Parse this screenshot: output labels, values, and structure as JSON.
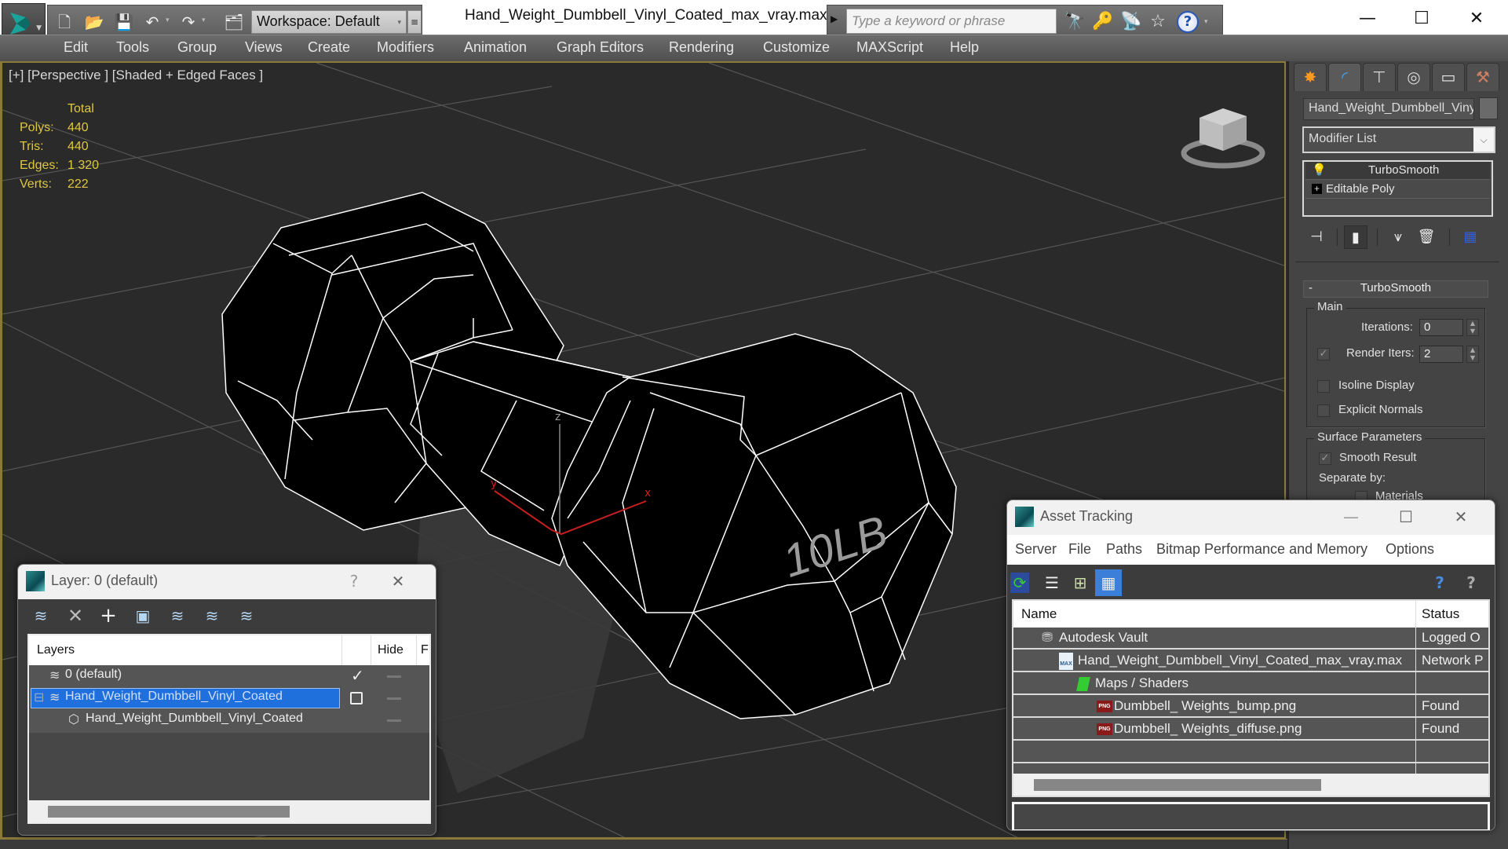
{
  "window": {
    "title": "Hand_Weight_Dumbbell_Vinyl_Coated_max_vray.max",
    "workspace_label": "Workspace: Default",
    "search_placeholder": "Type a keyword or phrase",
    "help_label": "?",
    "minimize": "—",
    "maximize": "☐",
    "close": "✕"
  },
  "quick_access": [
    {
      "icon": "new-file-icon",
      "glyph": "🗋"
    },
    {
      "icon": "open-folder-icon",
      "glyph": "📂"
    },
    {
      "icon": "save-icon",
      "glyph": "💾"
    },
    {
      "icon": "undo-icon",
      "glyph": "↶"
    },
    {
      "icon": "redo-icon",
      "glyph": "↷"
    },
    {
      "icon": "project-folder-icon",
      "glyph": "🗂"
    }
  ],
  "search_icons": [
    {
      "icon": "binoculars-icon",
      "glyph": "🔭"
    },
    {
      "icon": "key-icon",
      "glyph": "🔑"
    },
    {
      "icon": "satellite-icon",
      "glyph": "📡"
    },
    {
      "icon": "star-icon",
      "glyph": "☆"
    }
  ],
  "menu": [
    "Edit",
    "Tools",
    "Group",
    "Views",
    "Create",
    "Modifiers",
    "Animation",
    "Graph Editors",
    "Rendering",
    "Customize",
    "MAXScript",
    "Help"
  ],
  "viewport": {
    "label": "[+] [Perspective ] [Shaded + Edged Faces ]",
    "stats": {
      "header": "Total",
      "rows": [
        {
          "label": "Polys:",
          "value": "440"
        },
        {
          "label": "Tris:",
          "value": "440"
        },
        {
          "label": "Edges:",
          "value": "1 320"
        },
        {
          "label": "Verts:",
          "value": "222"
        }
      ]
    },
    "model_text": "10LB",
    "axis": {
      "x": "x",
      "y": "y",
      "z": "z"
    },
    "colors": {
      "stats": "#e0c840",
      "axis": "#c8201e",
      "wire": "#ffffff"
    }
  },
  "command_panel": {
    "tabs": [
      {
        "icon": "create-icon",
        "glyph": "✸",
        "color": "#ff9a20"
      },
      {
        "icon": "modify-icon",
        "glyph": "◜",
        "color": "#3fa6ff"
      },
      {
        "icon": "hierarchy-icon",
        "glyph": "⊤",
        "color": "#d8d8d8"
      },
      {
        "icon": "motion-icon",
        "glyph": "◎",
        "color": "#d8d8d8"
      },
      {
        "icon": "display-icon",
        "glyph": "▭",
        "color": "#e8e8e8"
      },
      {
        "icon": "utilities-icon",
        "glyph": "⚒",
        "color": "#d08060"
      }
    ],
    "object_name": "Hand_Weight_Dumbbell_Vinyl_Coated",
    "modifier_list": "Modifier List",
    "stack": [
      {
        "label": "TurboSmooth",
        "icon": "lightbulb-icon"
      },
      {
        "label": "Editable Poly",
        "icon": "expand-plus-icon"
      }
    ],
    "stack_tools": [
      {
        "icon": "pin-stack-icon",
        "glyph": "⊣"
      },
      {
        "icon": "show-end-result-icon",
        "glyph": "▮"
      },
      {
        "icon": "make-unique-icon",
        "glyph": "⩛"
      },
      {
        "icon": "remove-modifier-icon",
        "glyph": "🗑"
      },
      {
        "icon": "configure-sets-icon",
        "glyph": "▦"
      }
    ],
    "rollout": {
      "title": "TurboSmooth",
      "collapse": "-",
      "main_group": "Main",
      "iterations_label": "Iterations:",
      "iterations": "0",
      "render_iters_label": "Render Iters:",
      "render_iters": "2",
      "render_iters_checked": true,
      "isoline_label": "Isoline Display",
      "isoline_checked": false,
      "explicit_normals_label": "Explicit Normals",
      "explicit_normals_checked": false,
      "surface_group": "Surface Parameters",
      "smooth_result_label": "Smooth Result",
      "smooth_result_checked": true,
      "separate_by_label": "Separate by:",
      "materials_label": "Materials"
    }
  },
  "layer_dialog": {
    "title": "Layer: 0 (default)",
    "help": "?",
    "close": "✕",
    "toolbar": [
      {
        "icon": "new-layer-icon",
        "glyph": "≋"
      },
      {
        "icon": "delete-layer-icon",
        "glyph": "✕"
      },
      {
        "icon": "add-to-layer-icon",
        "glyph": "+"
      },
      {
        "icon": "select-objects-icon",
        "glyph": "▣"
      },
      {
        "icon": "select-layer-icon",
        "glyph": "≋"
      },
      {
        "icon": "highlight-layer-icon",
        "glyph": "≋"
      },
      {
        "icon": "freeze-layer-icon",
        "glyph": "≋"
      }
    ],
    "columns": {
      "name": "Layers",
      "hide": "Hide",
      "freeze": "F"
    },
    "rows": [
      {
        "name": "0 (default)",
        "current": "✓",
        "indent": 1
      },
      {
        "name": "Hand_Weight_Dumbbell_Vinyl_Coated",
        "expander": "⊟",
        "current": "",
        "indent": 1,
        "selected": true
      },
      {
        "name": "Hand_Weight_Dumbbell_Vinyl_Coated",
        "indent": 2,
        "object": true
      }
    ],
    "selection_color": "#1f6fdd"
  },
  "asset_tracking": {
    "title": "Asset Tracking",
    "minimize": "—",
    "maximize": "☐",
    "close": "✕",
    "menu": [
      "Server",
      "File",
      "Paths",
      "Bitmap Performance and Memory",
      "Options"
    ],
    "toolbar": [
      {
        "icon": "refresh-icon",
        "glyph": "⟳"
      },
      {
        "icon": "list-view-icon",
        "glyph": "☰"
      },
      {
        "icon": "tree-view-icon",
        "glyph": "⊞"
      },
      {
        "icon": "table-view-icon",
        "glyph": "▦",
        "active": true
      }
    ],
    "help_icons": [
      {
        "icon": "vault-help-icon",
        "glyph": "?"
      },
      {
        "icon": "context-help-icon",
        "glyph": "?"
      }
    ],
    "columns": {
      "name": "Name",
      "status": "Status"
    },
    "rows": [
      {
        "name": "Autodesk Vault",
        "status": "Logged O",
        "icon": "vault-icon",
        "indent": 1
      },
      {
        "name": "Hand_Weight_Dumbbell_Vinyl_Coated_max_vray.max",
        "status": "Network P",
        "icon": "max-file-icon",
        "indent": 2
      },
      {
        "name": "Maps / Shaders",
        "status": "",
        "icon": "maps-icon",
        "indent": 3
      },
      {
        "name": "Dumbbell_ Weights_bump.png",
        "status": "Found",
        "icon": "png-icon",
        "indent": 4
      },
      {
        "name": "Dumbbell_ Weights_diffuse.png",
        "status": "Found",
        "icon": "png-icon",
        "indent": 4
      },
      {
        "name": "",
        "status": ""
      },
      {
        "name": "",
        "status": ""
      }
    ]
  }
}
